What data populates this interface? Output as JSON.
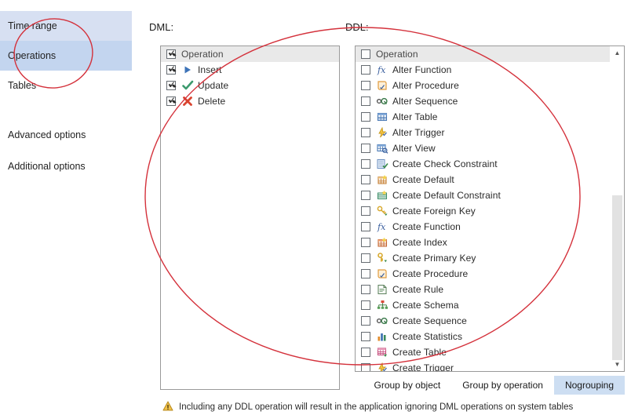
{
  "sidebar": {
    "items": [
      {
        "label": "Time range",
        "state": "hover"
      },
      {
        "label": "Operations",
        "state": "selected"
      },
      {
        "label": "Tables",
        "state": "normal"
      }
    ],
    "secondary": [
      {
        "label": "Advanced options"
      },
      {
        "label": "Additional options"
      }
    ]
  },
  "dml": {
    "caption": "DML:",
    "header": {
      "label": "Operation",
      "checked": true
    },
    "rows": [
      {
        "label": "Insert",
        "checked": true,
        "icon": "insert-arrow-icon"
      },
      {
        "label": "Update",
        "checked": true,
        "icon": "update-check-icon"
      },
      {
        "label": "Delete",
        "checked": true,
        "icon": "delete-cross-icon"
      }
    ]
  },
  "ddl": {
    "caption": "DDL:",
    "header": {
      "label": "Operation",
      "checked": false
    },
    "rows": [
      {
        "label": "Alter Function",
        "checked": false,
        "icon": "function-fx-icon"
      },
      {
        "label": "Alter Procedure",
        "checked": false,
        "icon": "procedure-icon"
      },
      {
        "label": "Alter Sequence",
        "checked": false,
        "icon": "sequence-icon"
      },
      {
        "label": "Alter Table",
        "checked": false,
        "icon": "table-icon"
      },
      {
        "label": "Alter Trigger",
        "checked": false,
        "icon": "trigger-icon"
      },
      {
        "label": "Alter View",
        "checked": false,
        "icon": "view-icon"
      },
      {
        "label": "Create Check Constraint",
        "checked": false,
        "icon": "check-constraint-icon"
      },
      {
        "label": "Create Default",
        "checked": false,
        "icon": "default-icon"
      },
      {
        "label": "Create Default Constraint",
        "checked": false,
        "icon": "default-constraint-icon"
      },
      {
        "label": "Create Foreign Key",
        "checked": false,
        "icon": "foreign-key-icon"
      },
      {
        "label": "Create Function",
        "checked": false,
        "icon": "function-fx-icon"
      },
      {
        "label": "Create Index",
        "checked": false,
        "icon": "index-icon"
      },
      {
        "label": "Create Primary Key",
        "checked": false,
        "icon": "primary-key-icon"
      },
      {
        "label": "Create Procedure",
        "checked": false,
        "icon": "procedure-icon"
      },
      {
        "label": "Create Rule",
        "checked": false,
        "icon": "rule-icon"
      },
      {
        "label": "Create Schema",
        "checked": false,
        "icon": "schema-icon"
      },
      {
        "label": "Create Sequence",
        "checked": false,
        "icon": "sequence-icon"
      },
      {
        "label": "Create Statistics",
        "checked": false,
        "icon": "statistics-icon"
      },
      {
        "label": "Create Table",
        "checked": false,
        "icon": "table-create-icon"
      },
      {
        "label": "Create Trigger",
        "checked": false,
        "icon": "trigger-icon"
      }
    ],
    "scrollbar": {
      "up_arrow": "▲",
      "down_arrow": "▼"
    }
  },
  "grouping": {
    "buttons": [
      {
        "label": "Group by object",
        "active": false
      },
      {
        "label": "Group by operation",
        "active": false
      },
      {
        "label": "No grouping",
        "active": true
      }
    ]
  },
  "warning": {
    "icon": "warning-triangle-icon",
    "text": "Including any DDL operation will result in the application ignoring DML operations on system tables"
  },
  "colors": {
    "selected_nav": "#c3d5ef",
    "hover_nav": "#d7e0f2",
    "active_button": "#cddef2",
    "annotation": "#d4313b",
    "list_header": "#e9e9e9"
  }
}
